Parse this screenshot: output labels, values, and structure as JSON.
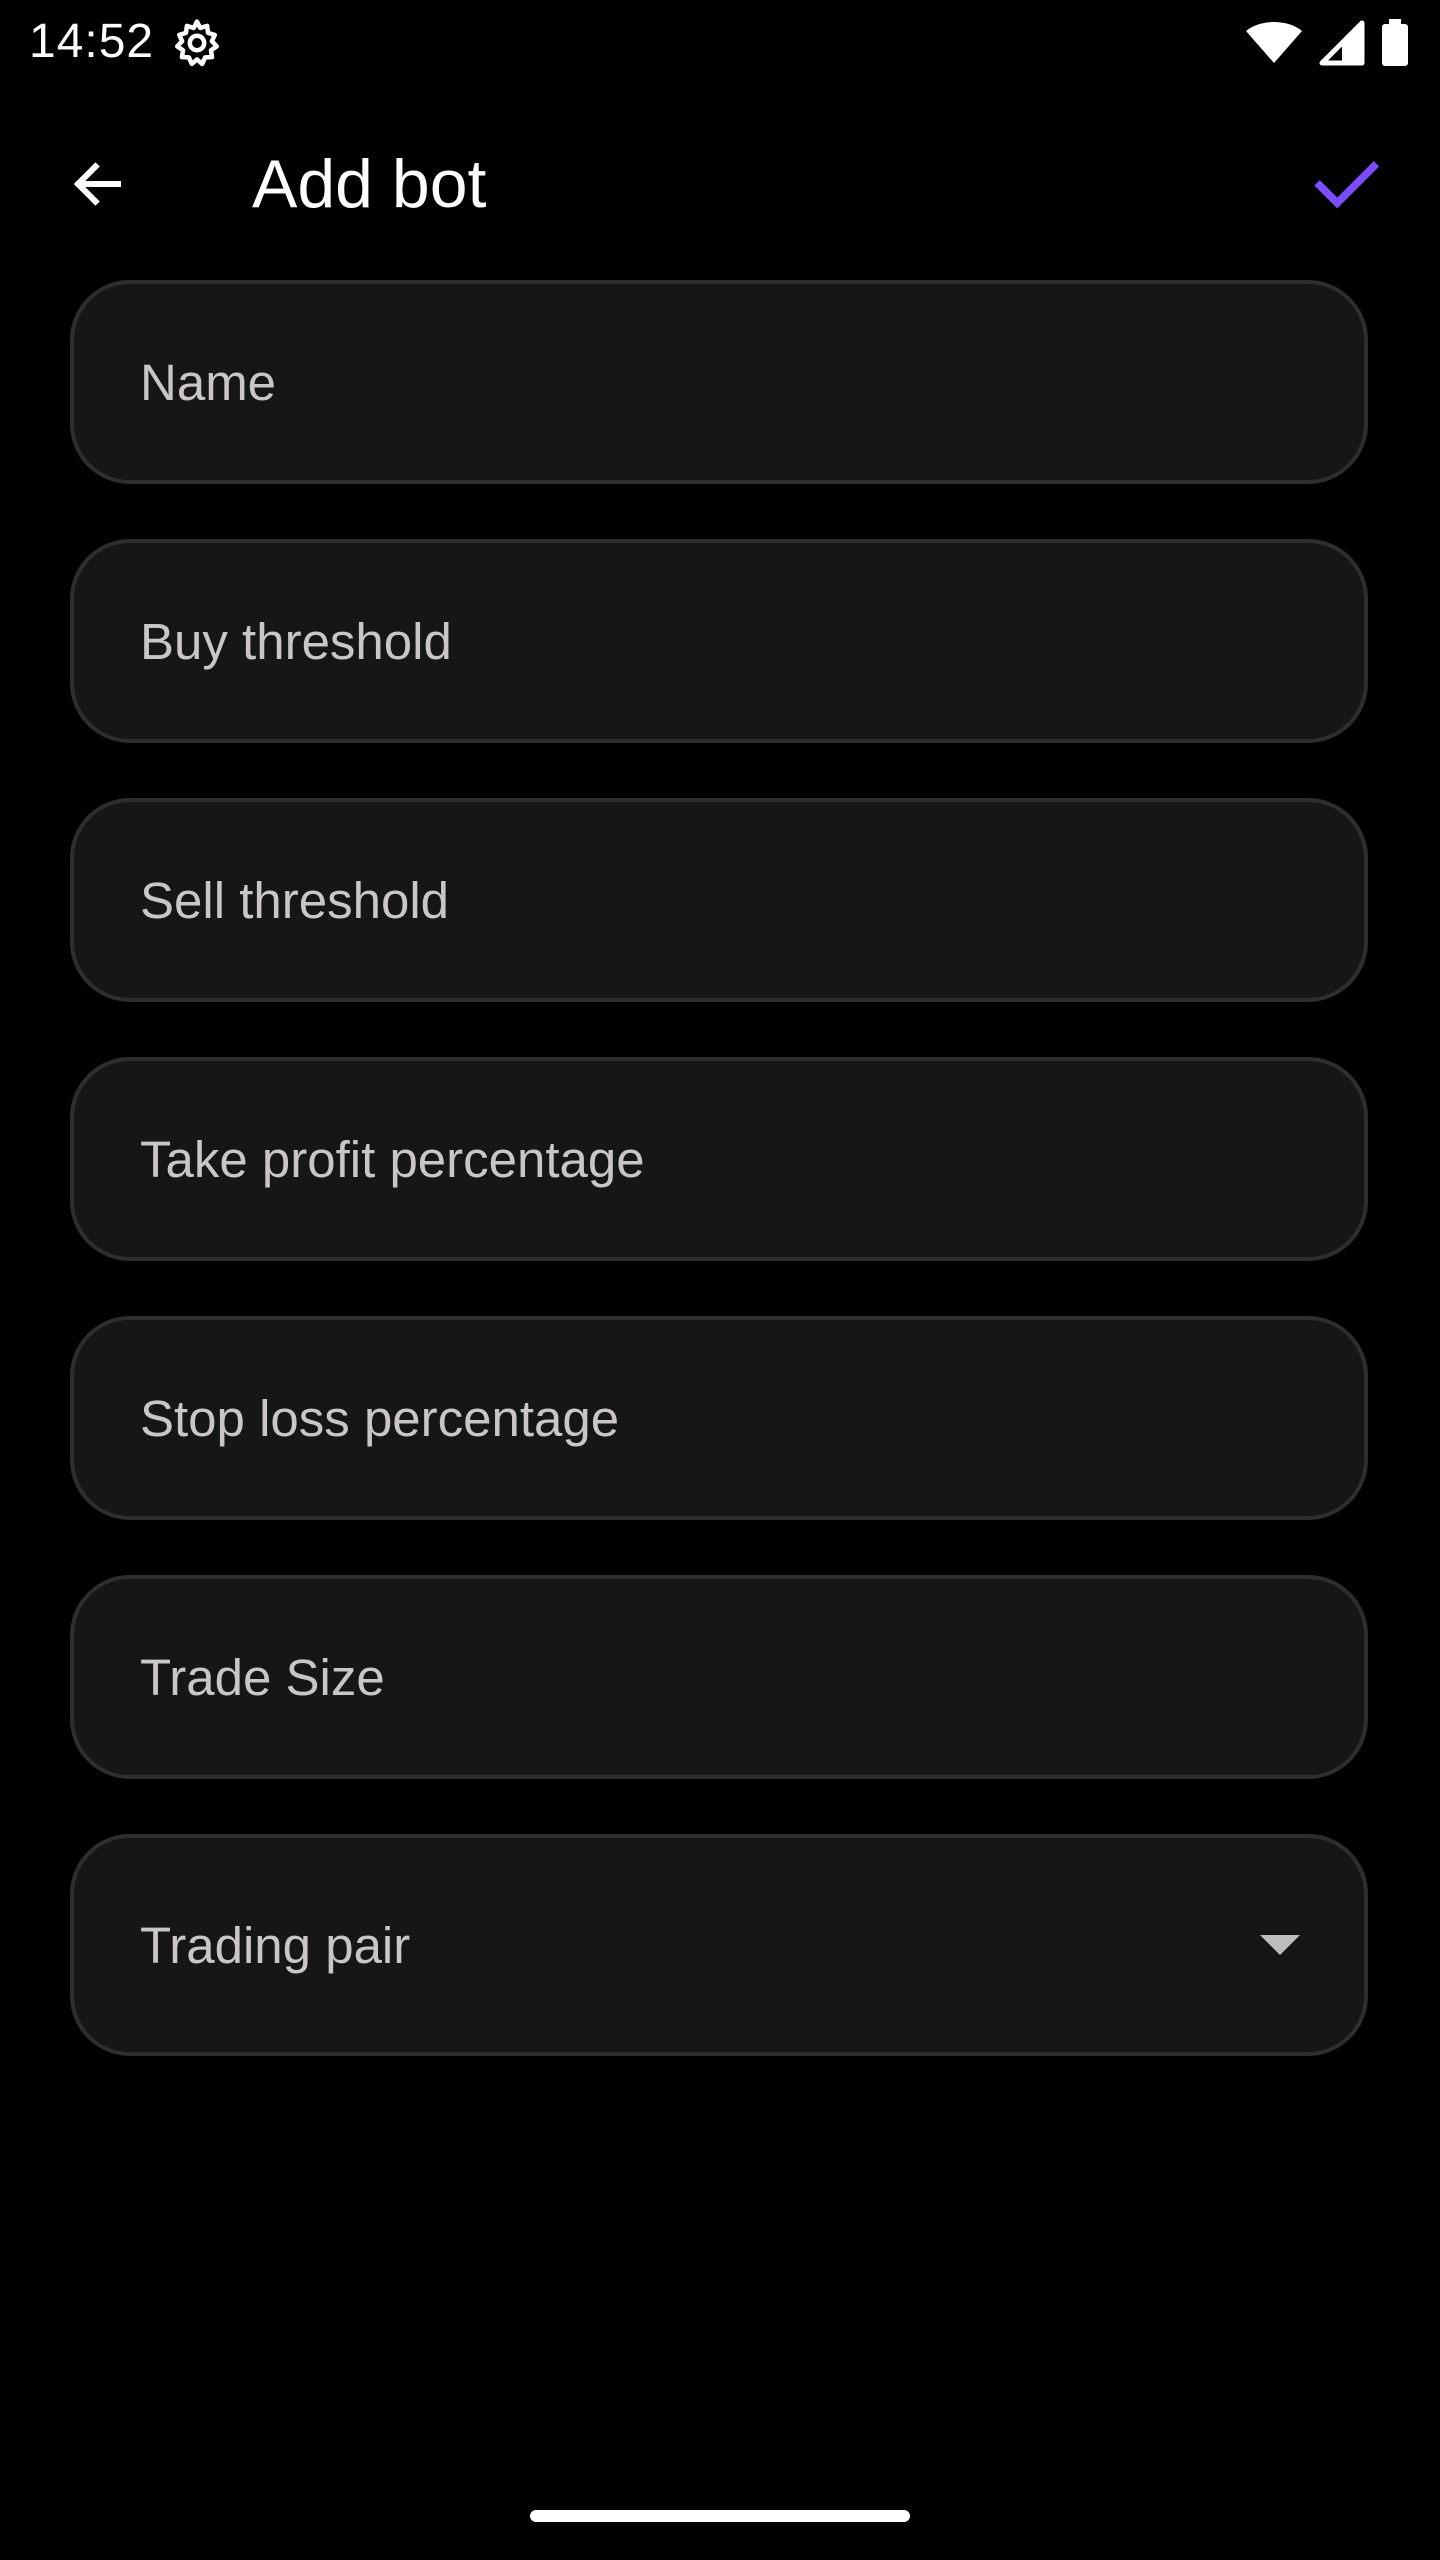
{
  "status_bar": {
    "time": "14:52",
    "icons": [
      "settings-gear-icon",
      "wifi-icon",
      "cellular-signal-icon",
      "battery-icon"
    ]
  },
  "app_bar": {
    "title": "Add bot",
    "back_icon": "arrow-back-icon",
    "confirm_icon": "check-icon",
    "accent_color": "#7c4dff"
  },
  "form": {
    "fields": [
      {
        "label": "Name"
      },
      {
        "label": "Buy threshold"
      },
      {
        "label": "Sell threshold"
      },
      {
        "label": "Take profit percentage"
      },
      {
        "label": "Stop loss percentage"
      },
      {
        "label": "Trade Size"
      }
    ],
    "trading_pair": {
      "label": "Trading pair",
      "icon": "dropdown-arrow-icon"
    }
  },
  "colors": {
    "background": "#000000",
    "field_fill": "#161616",
    "field_border": "#2e2e2e",
    "label_text": "#c9c5c9"
  }
}
